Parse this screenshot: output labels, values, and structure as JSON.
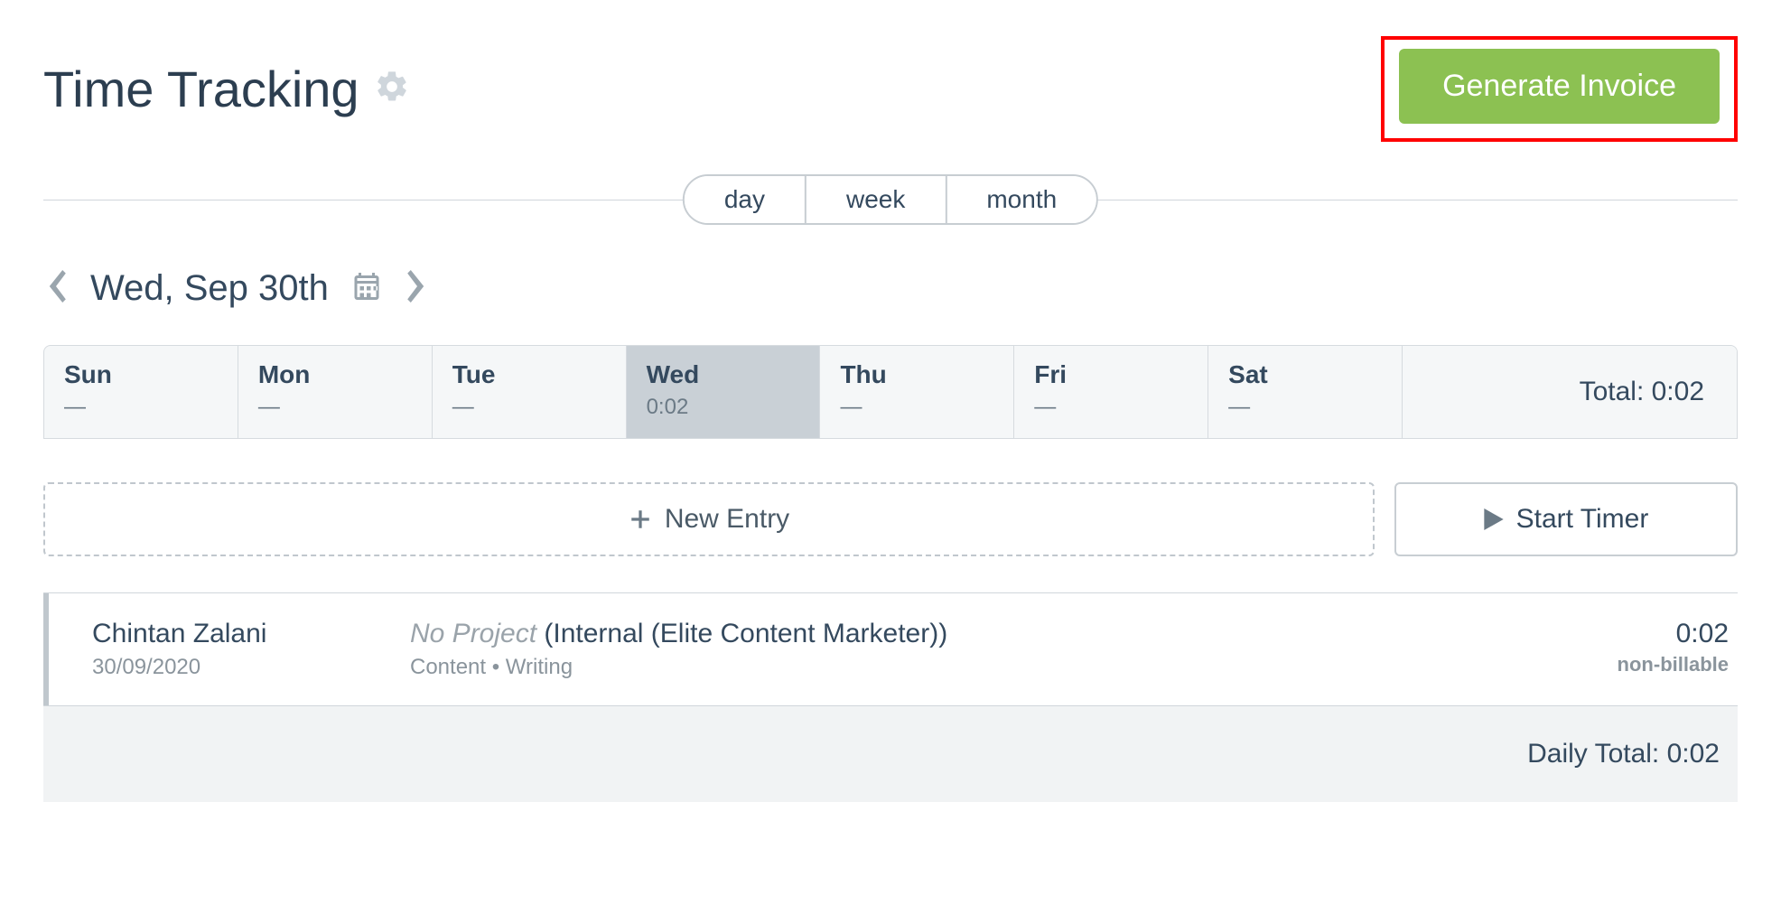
{
  "header": {
    "title": "Time Tracking",
    "generate_invoice_label": "Generate Invoice"
  },
  "view_toggle": {
    "day": "day",
    "week": "week",
    "month": "month"
  },
  "date_nav": {
    "current": "Wed, Sep 30th"
  },
  "week": {
    "days": [
      {
        "label": "Sun",
        "value": "—"
      },
      {
        "label": "Mon",
        "value": "—"
      },
      {
        "label": "Tue",
        "value": "—"
      },
      {
        "label": "Wed",
        "value": "0:02",
        "selected": true
      },
      {
        "label": "Thu",
        "value": "—"
      },
      {
        "label": "Fri",
        "value": "—"
      },
      {
        "label": "Sat",
        "value": "—"
      }
    ],
    "total_label": "Total: 0:02"
  },
  "actions": {
    "new_entry": "New Entry",
    "start_timer": "Start Timer"
  },
  "entries": [
    {
      "person": "Chintan Zalani",
      "date": "30/09/2020",
      "no_project_prefix": "No Project ",
      "client": "(Internal (Elite Content Marketer))",
      "tags": "Content  •  Writing",
      "time": "0:02",
      "billable": "non-billable"
    }
  ],
  "daily_total_label": "Daily Total: 0:02"
}
